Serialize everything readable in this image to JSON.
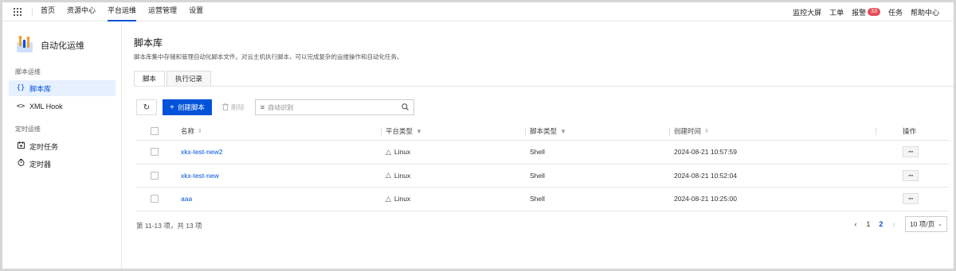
{
  "topnav": {
    "menu": [
      {
        "label": "首页",
        "active": false
      },
      {
        "label": "资源中心",
        "active": false
      },
      {
        "label": "平台运维",
        "active": true
      },
      {
        "label": "运营管理",
        "active": false
      },
      {
        "label": "设置",
        "active": false
      }
    ],
    "right": {
      "monitor": "监控大屏",
      "ticket": "工单",
      "alarm": "报警",
      "alarm_count": "33",
      "task": "任务",
      "help": "帮助中心"
    }
  },
  "sidebar": {
    "app_title": "自动化运维",
    "groups": [
      {
        "title": "脚本运维",
        "items": [
          {
            "icon": "braces-icon",
            "label": "脚本库",
            "active": true
          },
          {
            "icon": "code-icon",
            "label": "XML Hook",
            "active": false
          }
        ]
      },
      {
        "title": "定时运维",
        "items": [
          {
            "icon": "calendar-icon",
            "label": "定时任务",
            "active": false
          },
          {
            "icon": "timer-icon",
            "label": "定时器",
            "active": false
          }
        ]
      }
    ]
  },
  "main": {
    "title": "脚本库",
    "description": "脚本库集中存储和管理自动化脚本文件。对云主机执行脚本，可以完成复杂的运维操作和自动化任务。",
    "tabs": [
      {
        "label": "脚本",
        "active": true
      },
      {
        "label": "执行记录",
        "active": false
      }
    ],
    "toolbar": {
      "create_label": "创建脚本",
      "delete_label": "删除",
      "search_placeholder": "自动识别"
    },
    "table": {
      "columns": {
        "name": "名称",
        "platform": "平台类型",
        "script_type": "脚本类型",
        "created": "创建时间",
        "actions": "操作"
      },
      "rows": [
        {
          "name": "xkx-test-new2",
          "platform": "Linux",
          "script_type": "Shell",
          "created": "2024-08-21 10:57:59",
          "actions": "···"
        },
        {
          "name": "xkx-test-new",
          "platform": "Linux",
          "script_type": "Shell",
          "created": "2024-08-21 10:52:04",
          "actions": "···"
        },
        {
          "name": "aaa",
          "platform": "Linux",
          "script_type": "Shell",
          "created": "2024-08-21 10:25:00",
          "actions": "···"
        }
      ]
    },
    "footer": {
      "total_text": "第 11-13 项，共 13 项",
      "pages": [
        "1",
        "2"
      ],
      "current_page": "2",
      "page_size": "10 项/页"
    }
  },
  "colors": {
    "accent": "#0052d9",
    "badge": "#e34d59",
    "active_bg": "#e6f0ff"
  }
}
